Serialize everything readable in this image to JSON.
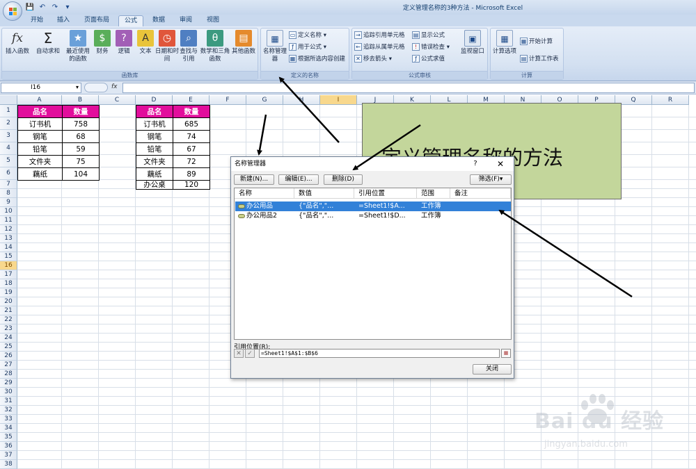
{
  "window": {
    "title": "定义管理名称的3种方法 - Microsoft Excel"
  },
  "tabs": [
    "开始",
    "插入",
    "页面布局",
    "公式",
    "数据",
    "审阅",
    "视图"
  ],
  "ribbon": {
    "function_library": {
      "group_label": "函数库",
      "buttons": [
        {
          "label": "插入函数",
          "icon": "fx-icon"
        },
        {
          "label": "自动求和",
          "icon": "sigma-icon"
        },
        {
          "label": "最近使用的函数",
          "icon": "book-icon"
        },
        {
          "label": "财务",
          "icon": "book-icon"
        },
        {
          "label": "逻辑",
          "icon": "book-icon"
        },
        {
          "label": "文本",
          "icon": "book-icon"
        },
        {
          "label": "日期和时间",
          "icon": "book-icon"
        },
        {
          "label": "查找与引用",
          "icon": "book-icon"
        },
        {
          "label": "数学和三角函数",
          "icon": "book-icon"
        },
        {
          "label": "其他函数",
          "icon": "book-icon"
        }
      ]
    },
    "defined_names": {
      "group_label": "定义的名称",
      "name_manager": "名称管理器",
      "define_name": "定义名称",
      "use_in_formula": "用于公式",
      "create_from_selection": "根据所选内容创建"
    },
    "formula_auditing": {
      "group_label": "公式审核",
      "trace_precedents": "追踪引用单元格",
      "trace_dependents": "追踪从属单元格",
      "remove_arrows": "移去箭头",
      "show_formulas": "显示公式",
      "error_checking": "错误检查",
      "evaluate_formula": "公式求值",
      "watch_window": "监视窗口"
    },
    "calculation": {
      "group_label": "计算",
      "calc_options": "计算选项",
      "calc_now": "开始计算",
      "calc_sheet": "计算工作表"
    }
  },
  "formula_bar": {
    "name_box": "I16",
    "fx": "fx",
    "formula": ""
  },
  "columns": [
    "A",
    "B",
    "C",
    "D",
    "E",
    "F",
    "G",
    "H",
    "I",
    "J",
    "K",
    "L",
    "M",
    "N",
    "O",
    "P",
    "Q",
    "R"
  ],
  "selected_column": "I",
  "selected_row": "16",
  "table1": {
    "headers": [
      "品名",
      "数量"
    ],
    "rows": [
      [
        "订书机",
        "758"
      ],
      [
        "钢笔",
        "68"
      ],
      [
        "铅笔",
        "59"
      ],
      [
        "文件夹",
        "75"
      ],
      [
        "藕纸",
        "104"
      ]
    ]
  },
  "table2": {
    "headers": [
      "品名",
      "数量"
    ],
    "rows": [
      [
        "订书机",
        "685"
      ],
      [
        "钢笔",
        "74"
      ],
      [
        "铅笔",
        "67"
      ],
      [
        "文件夹",
        "72"
      ],
      [
        "藕纸",
        "89"
      ],
      [
        "办公桌",
        "120"
      ]
    ]
  },
  "textbox": {
    "text": "定义管理名称的方法"
  },
  "dialog": {
    "title": "名称管理器",
    "help": "?",
    "close": "✕",
    "new_button": "新建(N)...",
    "edit_button": "编辑(E)...",
    "delete_button": "删除(D)",
    "filter_button": "筛选(F)▾",
    "columns": [
      "名称",
      "数值",
      "引用位置",
      "范围",
      "备注"
    ],
    "items": [
      {
        "name": "办公用品",
        "value": "{\"品名\",\"...",
        "refers_to": "=Sheet1!$A...",
        "scope": "工作簿",
        "comment": "",
        "selected": true
      },
      {
        "name": "办公用品2",
        "value": "{\"品名\",\"...",
        "refers_to": "=Sheet1!$D...",
        "scope": "工作簿",
        "comment": "",
        "selected": false
      }
    ],
    "refers_to_label": "引用位置(R):",
    "refers_to_value": "=Sheet1!$A$1:$B$6",
    "close_button": "关闭"
  },
  "watermark": {
    "brand": "Bai du 经验",
    "url": "jingyan.baidu.com"
  },
  "colors": {
    "header_fill": "#e20e9c",
    "textbox_fill": "#c3d69b",
    "selection": "#3281d8"
  }
}
